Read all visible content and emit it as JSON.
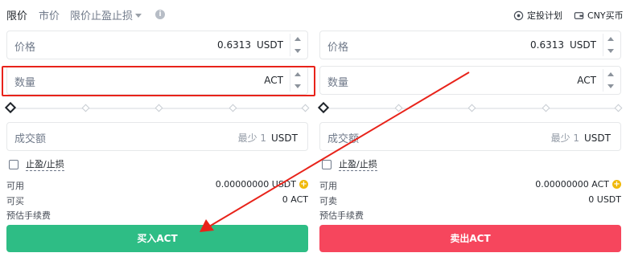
{
  "tabs": [
    {
      "label": "限价"
    },
    {
      "label": "市价"
    },
    {
      "label": "限价止盈止损"
    }
  ],
  "top_right": {
    "plan": "定投计划",
    "buy_cny": "CNY买币"
  },
  "buy": {
    "price_label": "价格",
    "price_value": "0.6313",
    "price_unit": "USDT",
    "amount_label": "数量",
    "amount_unit": "ACT",
    "total_label": "成交额",
    "total_hint": "最少 1",
    "total_unit": "USDT",
    "tpsl_label": "止盈/止损",
    "available_label": "可用",
    "available_value": "0.00000000 USDT",
    "can_label": "可买",
    "can_value": "0 ACT",
    "fee_label": "预估手续费",
    "button": "买入ACT"
  },
  "sell": {
    "price_label": "价格",
    "price_value": "0.6313",
    "price_unit": "USDT",
    "amount_label": "数量",
    "amount_unit": "ACT",
    "total_label": "成交额",
    "total_hint": "最少 1",
    "total_unit": "USDT",
    "tpsl_label": "止盈/止损",
    "available_label": "可用",
    "available_value": "0.00000000 ACT",
    "can_label": "可卖",
    "can_value": "0 USDT",
    "fee_label": "预估手续费",
    "button": "卖出ACT"
  },
  "colors": {
    "buy": "#2ebd85",
    "sell": "#f6465d",
    "annotation": "#e8231a",
    "accent": "#f0b90b"
  },
  "slider": {
    "buy_percent": 0,
    "sell_percent": 0
  }
}
